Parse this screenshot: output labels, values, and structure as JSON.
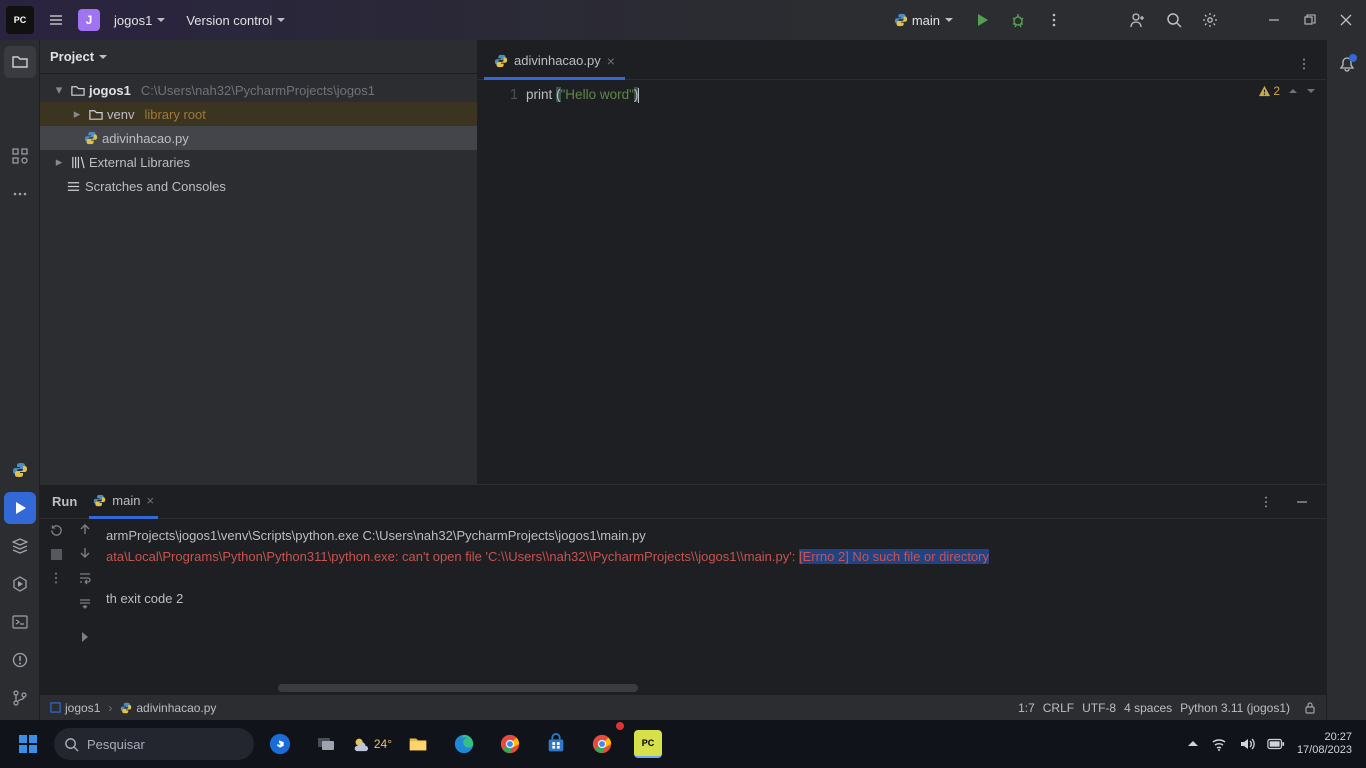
{
  "titlebar": {
    "project_initial": "J",
    "project_name": "jogos1",
    "version_control": "Version control",
    "run_config": "main"
  },
  "project_panel": {
    "title": "Project",
    "root_name": "jogos1",
    "root_path": "C:\\Users\\nah32\\PycharmProjects\\jogos1",
    "venv_name": "venv",
    "venv_tag": "library root",
    "file_name": "adivinhacao.py",
    "external_libs": "External Libraries",
    "scratches": "Scratches and Consoles"
  },
  "editor": {
    "tab_name": "adivinhacao.py",
    "line_number": "1",
    "code_fn": "print ",
    "code_open": "(",
    "code_str": "\"Hello word\"",
    "code_close": ")",
    "warn_count": "2"
  },
  "run_panel": {
    "title": "Run",
    "tab_name": "main",
    "line1": "armProjects\\jogos1\\venv\\Scripts\\python.exe C:\\Users\\nah32\\PycharmProjects\\jogos1\\main.py",
    "line2a": "ata\\Local\\Programs\\Python\\Python311\\python.exe: can't open file 'C:\\\\Users\\\\nah32\\\\PycharmProjects\\\\jogos1\\\\main.py': ",
    "line2b": "[Errno 2] No such file or directory",
    "line3": "th exit code 2"
  },
  "status": {
    "crumb1": "jogos1",
    "crumb2": "adivinhacao.py",
    "pos": "1:7",
    "eol": "CRLF",
    "enc": "UTF-8",
    "indent": "4 spaces",
    "interp": "Python 3.11 (jogos1)"
  },
  "taskbar": {
    "search_placeholder": "Pesquisar",
    "temp": "24°",
    "time": "20:27",
    "date": "17/08/2023"
  }
}
